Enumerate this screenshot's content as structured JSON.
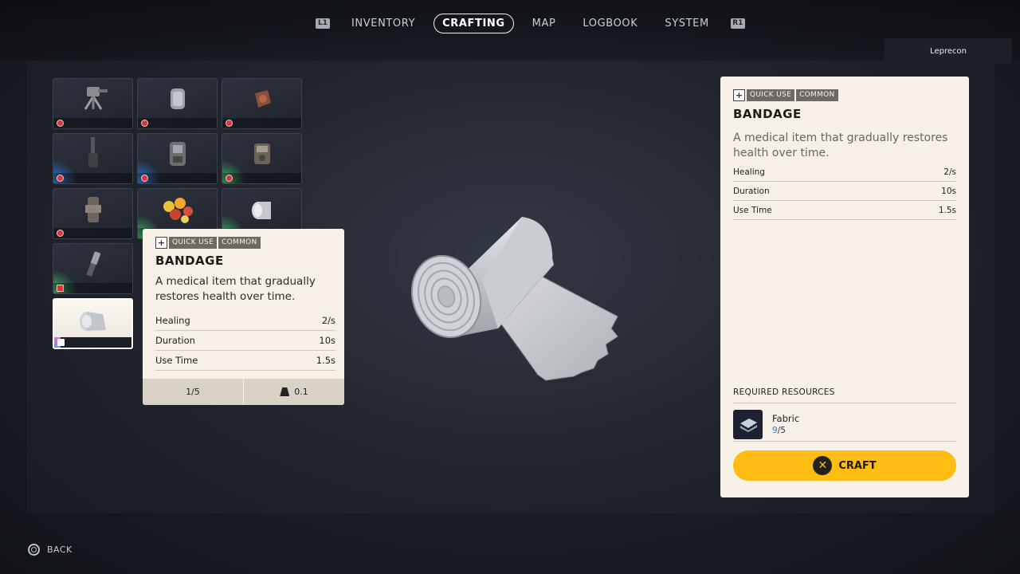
{
  "nav": {
    "left_hint": "L1",
    "right_hint": "R1",
    "tabs": [
      {
        "label": "INVENTORY",
        "active": false
      },
      {
        "label": "CRAFTING",
        "active": true
      },
      {
        "label": "MAP",
        "active": false
      },
      {
        "label": "LOGBOOK",
        "active": false
      },
      {
        "label": "SYSTEM",
        "active": false
      }
    ]
  },
  "player": {
    "name": "Leprecon"
  },
  "grid": {
    "slots": [
      {
        "item_icon": "turret-icon",
        "rarity": "gray",
        "badge": "red-circle"
      },
      {
        "item_icon": "canister-icon",
        "rarity": "gray",
        "badge": "red-circle"
      },
      {
        "item_icon": "mine-icon",
        "rarity": "gray",
        "badge": "red-circle"
      },
      {
        "item_icon": "grenade-icon",
        "rarity": "blue",
        "badge": "red-circle"
      },
      {
        "item_icon": "launcher-icon",
        "rarity": "blue",
        "badge": "red-circle"
      },
      {
        "item_icon": "gadget-icon",
        "rarity": "green",
        "badge": "red-circle"
      },
      {
        "item_icon": "device-icon",
        "rarity": "gray",
        "badge": "red-circle"
      },
      {
        "item_icon": "fruit-icon",
        "rarity": "green",
        "badge": "none"
      },
      {
        "item_icon": "bandage-icon",
        "rarity": "green",
        "badge": "none"
      },
      {
        "item_icon": "injector-icon",
        "rarity": "green",
        "badge": "red-square"
      },
      {
        "item_icon": "bandage-icon",
        "rarity": "gray",
        "badge": "plus",
        "selected": true
      }
    ]
  },
  "tooltip": {
    "tag_icon": "+",
    "tags": [
      "QUICK USE",
      "COMMON"
    ],
    "title": "BANDAGE",
    "description": "A medical item that gradually restores health over time.",
    "stats": [
      {
        "label": "Healing",
        "value": "2/s"
      },
      {
        "label": "Duration",
        "value": "10s"
      },
      {
        "label": "Use Time",
        "value": "1.5s"
      }
    ],
    "stack": "1/5",
    "weight": "0.1"
  },
  "detail": {
    "tag_icon": "+",
    "tags": [
      "QUICK USE",
      "COMMON"
    ],
    "title": "BANDAGE",
    "description": "A medical item that gradually restores health over time.",
    "stats": [
      {
        "label": "Healing",
        "value": "2/s"
      },
      {
        "label": "Duration",
        "value": "10s"
      },
      {
        "label": "Use Time",
        "value": "1.5s"
      }
    ],
    "required_label": "REQUIRED RESOURCES",
    "resource": {
      "name": "Fabric",
      "have": "9",
      "need": "/5"
    },
    "craft_label": "CRAFT",
    "craft_glyph": "✕"
  },
  "footer": {
    "back_label": "BACK"
  },
  "colors": {
    "accent_yellow": "#ffbd13",
    "card_bg": "#f6f0e6",
    "rarity_blue": "#2d8cff",
    "rarity_green": "#3fd66f"
  }
}
